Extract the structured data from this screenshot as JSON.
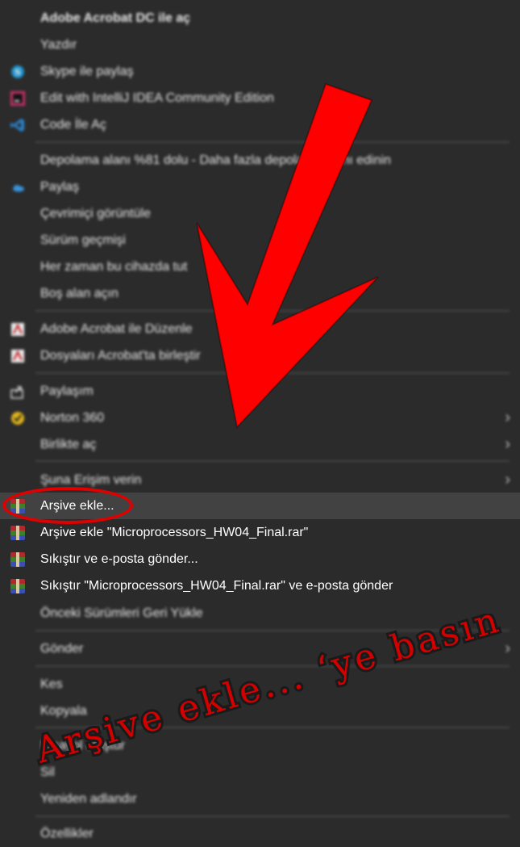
{
  "menu": {
    "items": [
      {
        "label": "Adobe Acrobat DC ile aç",
        "icon": "none"
      },
      {
        "label": "Yazdır",
        "icon": "none"
      },
      {
        "label": "Skype ile paylaş",
        "icon": "skype-icon"
      },
      {
        "label": "Edit with IntelliJ IDEA Community Edition",
        "icon": "intellij-icon"
      },
      {
        "label": "Code İle Aç",
        "icon": "vscode-icon"
      },
      {
        "label": "Depolama alanı %81 dolu - Daha fazla depolama alanı edinin",
        "icon": "none"
      },
      {
        "label": "Paylaş",
        "icon": "onedrive-icon"
      },
      {
        "label": "Çevrimiçi görüntüle",
        "icon": "none"
      },
      {
        "label": "Sürüm geçmişi",
        "icon": "none"
      },
      {
        "label": "Her zaman bu cihazda tut",
        "icon": "none"
      },
      {
        "label": "Boş alan açın",
        "icon": "none"
      },
      {
        "label": "Adobe Acrobat ile Düzenle",
        "icon": "acrobat-icon"
      },
      {
        "label": "Dosyaları Acrobat'ta birleştir",
        "icon": "acrobat-icon"
      },
      {
        "label": "Paylaşım",
        "icon": "share-icon"
      },
      {
        "label": "Norton 360",
        "icon": "norton-icon"
      },
      {
        "label": "Birlikte aç",
        "icon": "none"
      },
      {
        "label": "Şuna Erişim verin",
        "icon": "none"
      },
      {
        "label": "Arşive ekle...",
        "icon": "winrar-icon"
      },
      {
        "label": "Arşive ekle \"Microprocessors_HW04_Final.rar\"",
        "icon": "winrar-icon"
      },
      {
        "label": "Sıkıştır ve e-posta gönder...",
        "icon": "winrar-icon"
      },
      {
        "label": "Sıkıştır \"Microprocessors_HW04_Final.rar\" ve e-posta gönder",
        "icon": "winrar-icon"
      },
      {
        "label": "Önceki Sürümleri Geri Yükle",
        "icon": "none"
      },
      {
        "label": "Gönder",
        "icon": "none"
      },
      {
        "label": "Kes",
        "icon": "none"
      },
      {
        "label": "Kopyala",
        "icon": "none"
      },
      {
        "label": "Kısayol oluştur",
        "icon": "none"
      },
      {
        "label": "Sil",
        "icon": "none"
      },
      {
        "label": "Yeniden adlandır",
        "icon": "none"
      },
      {
        "label": "Özellikler",
        "icon": "none"
      }
    ],
    "submenu_glyph": "›"
  },
  "annotation": {
    "text": "Arşive ekle... ‘ye basın",
    "color": "#e10000"
  },
  "colors": {
    "menu_bg": "#2b2b2b",
    "highlight": "#424242",
    "separator": "#4a4a4a",
    "arrow": "#ff0000"
  }
}
